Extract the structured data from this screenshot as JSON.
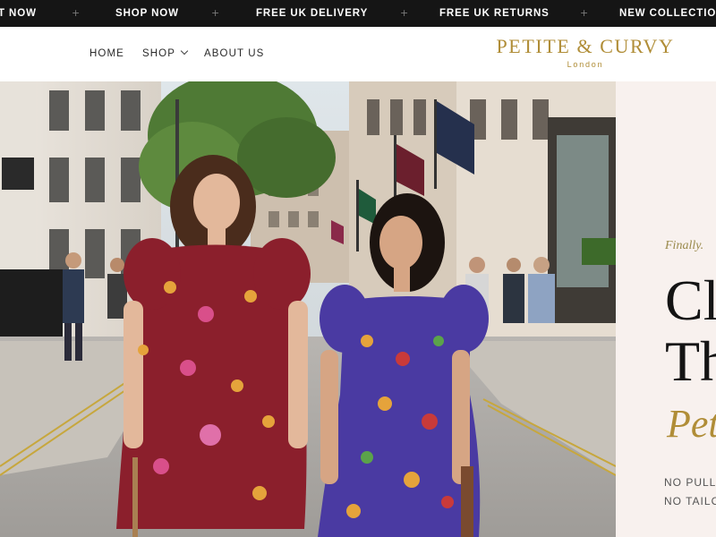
{
  "announcement_bar": {
    "items": [
      "T NOW",
      "SHOP NOW",
      "FREE UK DELIVERY",
      "FREE UK RETURNS",
      "NEW COLLECTION"
    ],
    "separator": "+"
  },
  "header": {
    "nav": {
      "home": "HOME",
      "shop": "SHOP",
      "about": "ABOUT US"
    },
    "logo": {
      "name": "PETITE & CURVY",
      "location": "London"
    }
  },
  "hero": {
    "eyebrow": "Finally.",
    "headline_line1": "Cl",
    "headline_line2": "Th",
    "headline_italic": "Pet",
    "features": [
      "NO PULLI",
      "NO TAILO"
    ]
  },
  "colors": {
    "announcement_bg": "#151515",
    "brand_gold": "#b08d37",
    "panel_bg": "#f8f1ee",
    "text_dark": "#141414"
  },
  "icons": {
    "shop_dropdown": "chevron-down-icon",
    "announcement_separator": "plus-icon"
  }
}
